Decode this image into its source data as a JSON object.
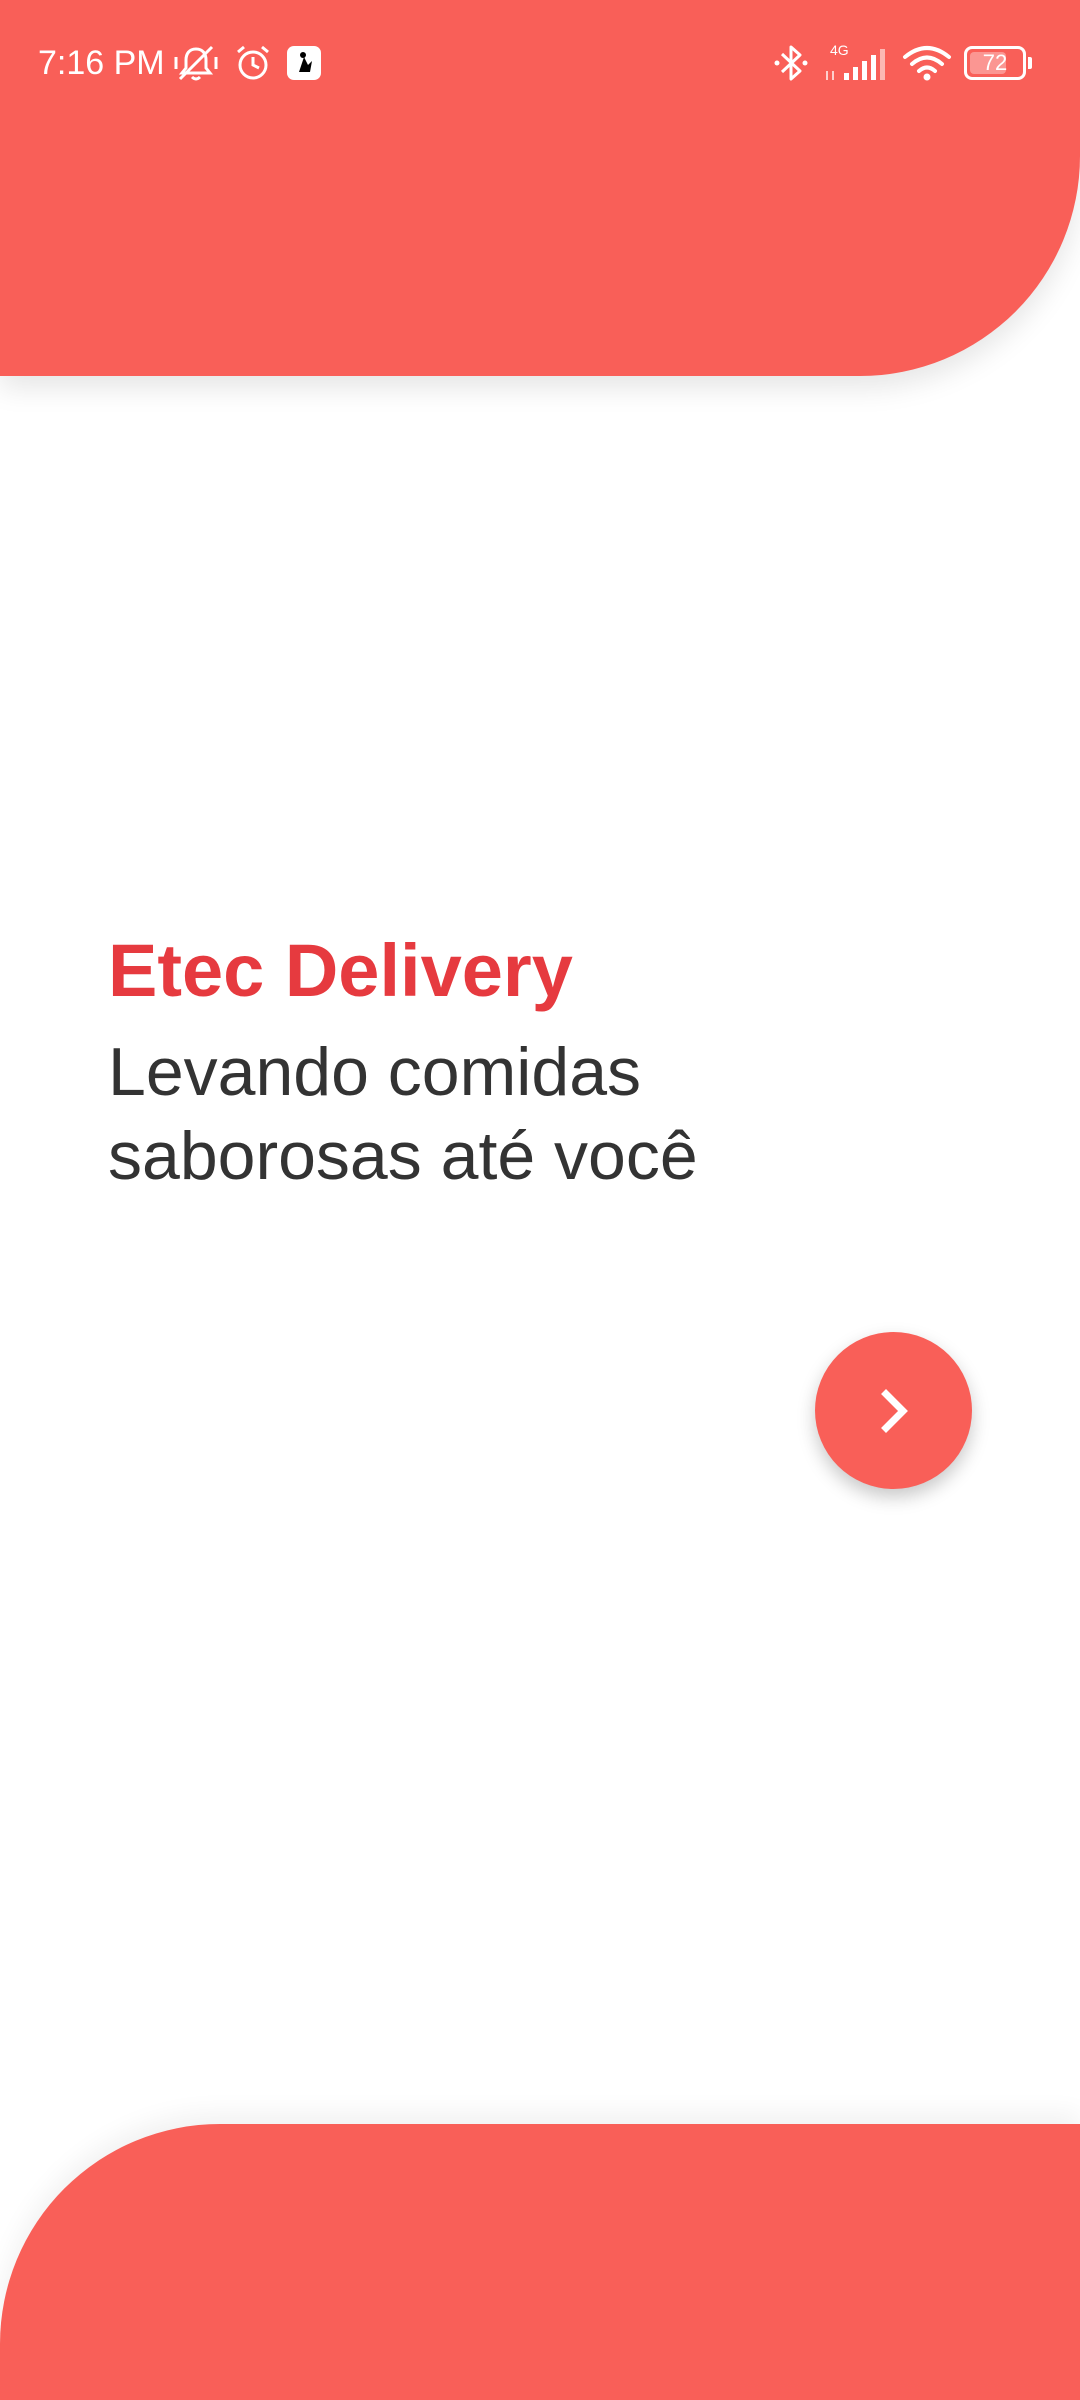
{
  "status_bar": {
    "time": "7:16 PM",
    "network": "4G",
    "battery": "72",
    "battery_level": 0.72,
    "icons": [
      "mute-icon",
      "alarm-icon",
      "app-notification-icon",
      "bluetooth-icon",
      "signal-icon",
      "wifi-icon",
      "battery-icon"
    ]
  },
  "content": {
    "brand": "Etec Delivery",
    "tagline_line1": "Levando comidas",
    "tagline_line2": "saborosas até você"
  },
  "next_button": {
    "icon": "chevron-right-icon"
  },
  "colors": {
    "accent": "#F95F58",
    "brand_text": "#E63A3F",
    "body_text": "#333333",
    "background": "#FFFFFF"
  }
}
